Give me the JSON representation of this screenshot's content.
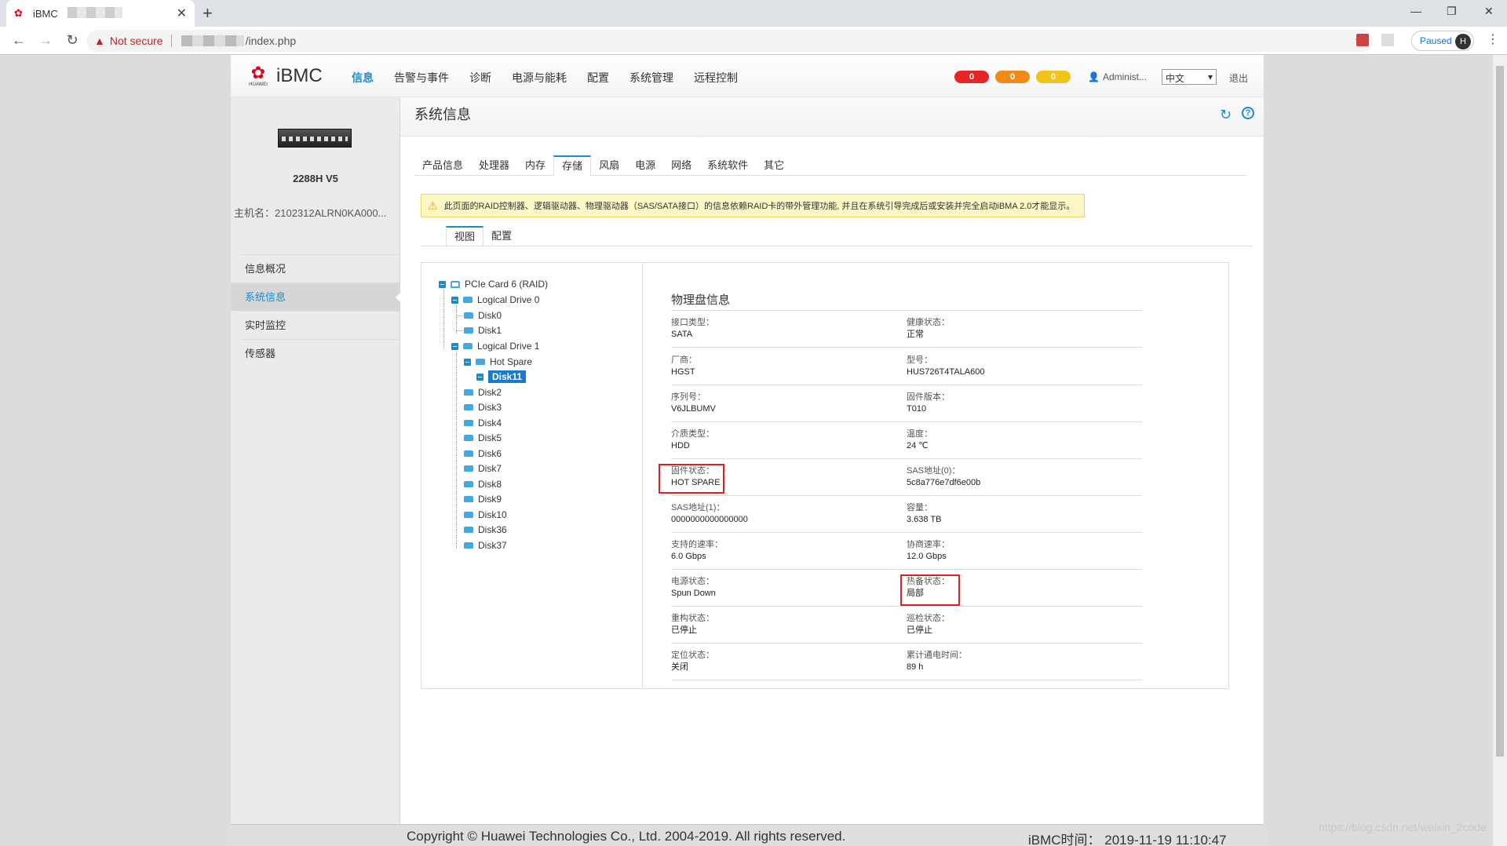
{
  "browser": {
    "tab_title": "iBMC",
    "not_secure": "Not secure",
    "url_path": "/index.php",
    "paused": "Paused",
    "avatar": "H"
  },
  "header": {
    "brand": "iBMC",
    "brand_sub": "HUAWEI",
    "nav": [
      "信息",
      "告警与事件",
      "诊断",
      "电源与能耗",
      "配置",
      "系统管理",
      "远程控制"
    ],
    "badges": [
      {
        "count": "0",
        "color": "#e82424"
      },
      {
        "count": "0",
        "color": "#f08a18"
      },
      {
        "count": "0",
        "color": "#f0c418"
      }
    ],
    "user": "Administ...",
    "language": "中文",
    "logout": "退出"
  },
  "sidebar": {
    "model": "2288H V5",
    "hostname": "主机名：2102312ALRN0KA000...",
    "items": [
      "信息概况",
      "系统信息",
      "实时监控",
      "传感器"
    ]
  },
  "page": {
    "title": "系统信息",
    "tabs": [
      "产品信息",
      "处理器",
      "内存",
      "存储",
      "风扇",
      "电源",
      "网络",
      "系统软件",
      "其它"
    ],
    "notice": "此页面的RAID控制器、逻辑驱动器、物理驱动器（SAS/SATA接口）的信息依赖RAID卡的带外管理功能, 并且在系统引导完成后或安装并完全启动iBMA 2.0才能显示。",
    "subtabs": [
      "视图",
      "配置"
    ]
  },
  "tree": {
    "card": "PCIe Card 6 (RAID)",
    "ld0": "Logical Drive 0",
    "disk0": "Disk0",
    "disk1": "Disk1",
    "ld1": "Logical Drive 1",
    "hotspare": "Hot Spare",
    "disk11": "Disk11",
    "disks": [
      "Disk2",
      "Disk3",
      "Disk4",
      "Disk5",
      "Disk6",
      "Disk7",
      "Disk8",
      "Disk9",
      "Disk10",
      "Disk36",
      "Disk37"
    ]
  },
  "detail": {
    "title": "物理盘信息",
    "rows": [
      [
        {
          "label": "接口类型：",
          "value": "SATA"
        },
        {
          "label": "健康状态：",
          "value": "正常"
        }
      ],
      [
        {
          "label": "厂商：",
          "value": "HGST"
        },
        {
          "label": "型号：",
          "value": "HUS726T4TALA600"
        }
      ],
      [
        {
          "label": "序列号：",
          "value": "V6JLBUMV"
        },
        {
          "label": "固件版本：",
          "value": "T010"
        }
      ],
      [
        {
          "label": "介质类型：",
          "value": "HDD"
        },
        {
          "label": "温度：",
          "value": "24 ℃"
        }
      ],
      [
        {
          "label": "固件状态：",
          "value": "HOT SPARE"
        },
        {
          "label": "SAS地址(0)：",
          "value": "5c8a776e7df6e00b"
        }
      ],
      [
        {
          "label": "SAS地址(1)：",
          "value": "0000000000000000"
        },
        {
          "label": "容量：",
          "value": "3.638 TB"
        }
      ],
      [
        {
          "label": "支持的速率：",
          "value": "6.0 Gbps"
        },
        {
          "label": "协商速率：",
          "value": "12.0 Gbps"
        }
      ],
      [
        {
          "label": "电源状态：",
          "value": "Spun Down"
        },
        {
          "label": "热备状态：",
          "value": "局部"
        }
      ],
      [
        {
          "label": "重构状态：",
          "value": "已停止"
        },
        {
          "label": "巡检状态：",
          "value": "已停止"
        }
      ],
      [
        {
          "label": "定位状态：",
          "value": "关闭"
        },
        {
          "label": "累计通电时间：",
          "value": "89 h"
        }
      ]
    ]
  },
  "footer": {
    "copyright": "Copyright © Huawei Technologies Co., Ltd. 2004-2019. All rights reserved.",
    "time": "iBMC时间： 2019-11-19 11:10:47",
    "watermark": "https://blog.csdn.net/weixin_2code"
  }
}
